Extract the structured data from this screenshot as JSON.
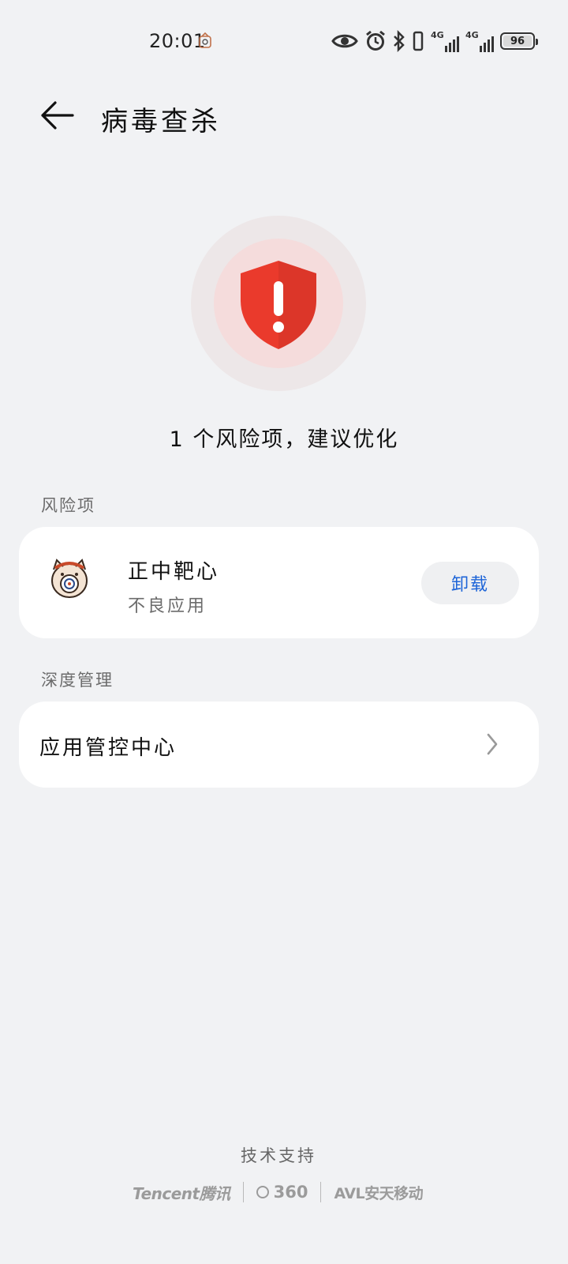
{
  "status_bar": {
    "time": "20:01",
    "network_1": "4G",
    "network_2": "4G",
    "battery_level": "96",
    "icons": [
      "eye-icon",
      "alarm-icon",
      "bluetooth-icon",
      "vibrate-icon",
      "signal-icon",
      "signal-icon",
      "battery-icon"
    ]
  },
  "header": {
    "title": "病毒查杀"
  },
  "hero": {
    "summary": "1 个风险项，建议优化",
    "status_color": "#ea3a2c"
  },
  "risk_section": {
    "label": "风险项",
    "items": [
      {
        "name": "正中靶心",
        "type": "不良应用",
        "action": "卸载"
      }
    ]
  },
  "deep_section": {
    "label": "深度管理",
    "items": [
      {
        "label": "应用管控中心"
      }
    ]
  },
  "footer": {
    "support_label": "技术支持",
    "partners": [
      "Tencent腾讯",
      "360",
      "AVL安天移动"
    ]
  },
  "colors": {
    "accent": "#1d64d8",
    "background": "#f1f2f4",
    "danger": "#ea3a2c"
  }
}
